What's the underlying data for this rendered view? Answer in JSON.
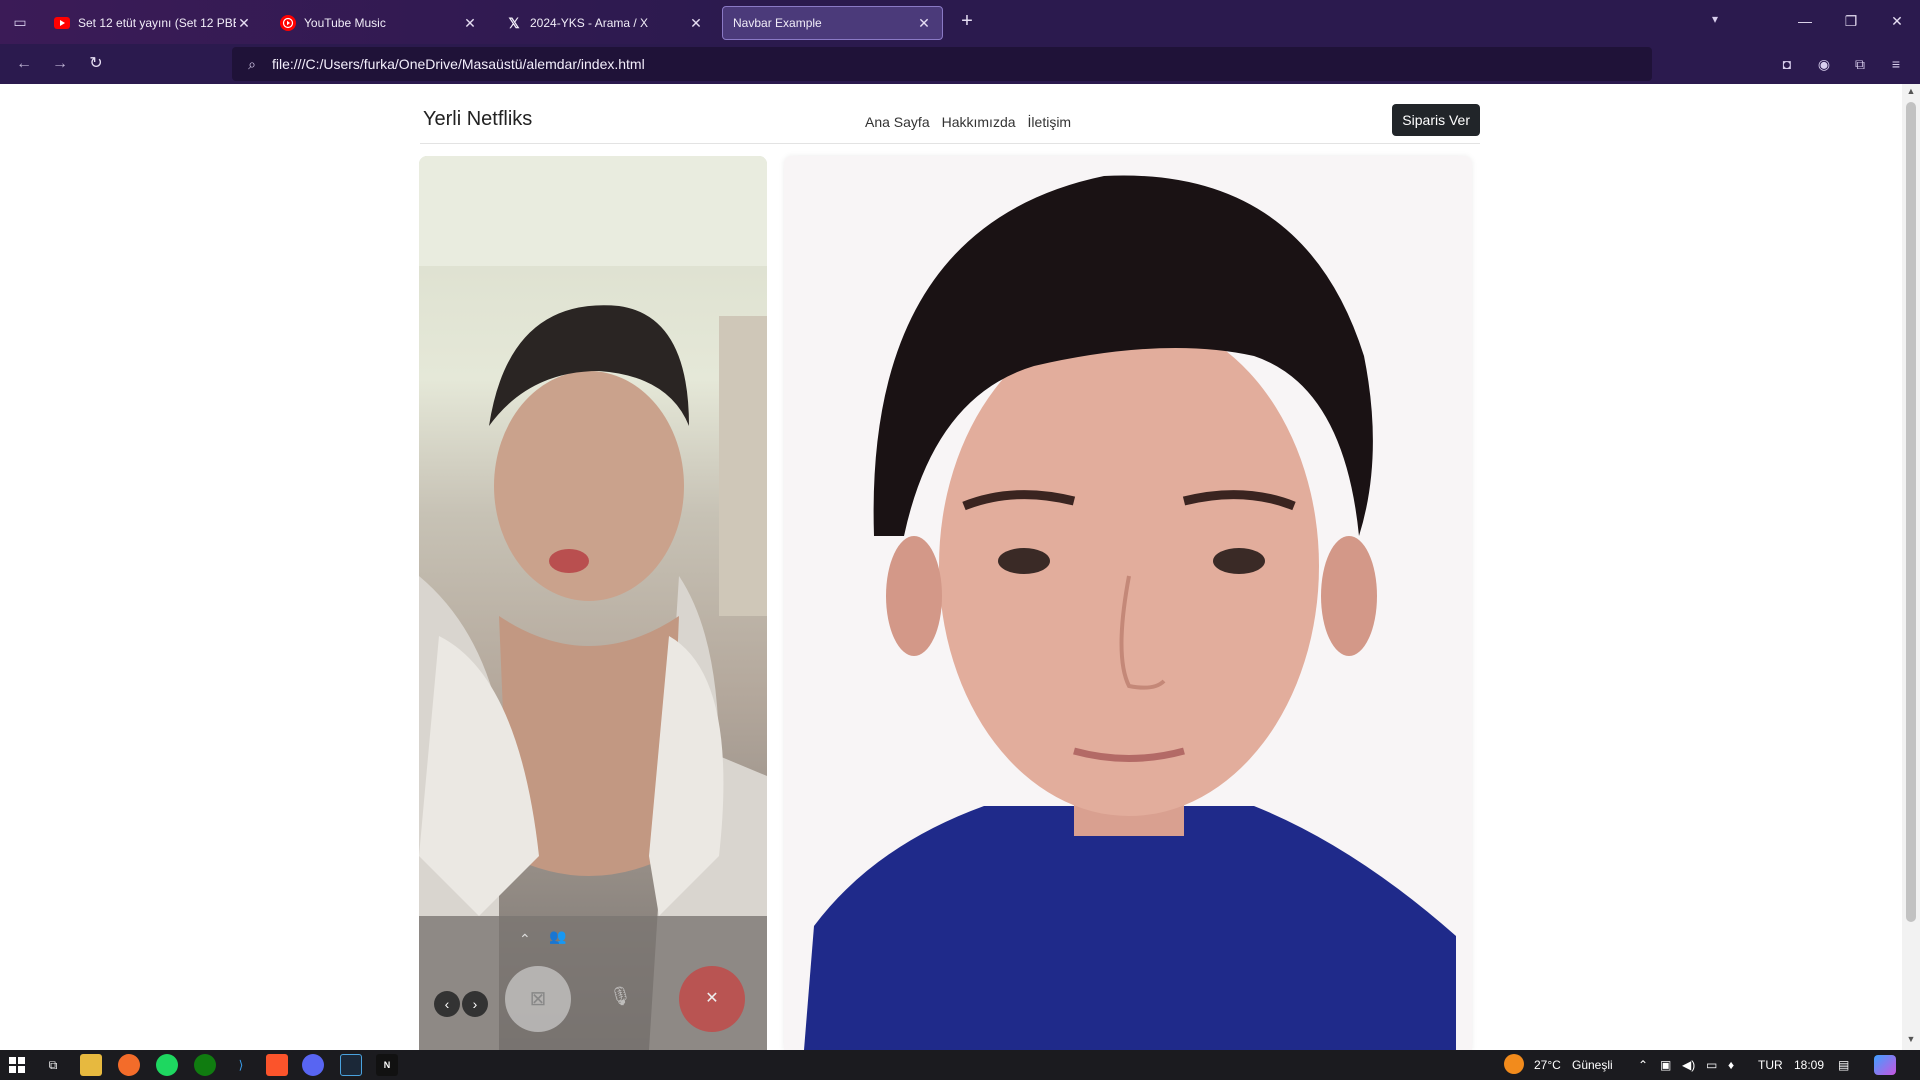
{
  "browser": {
    "tabs": [
      {
        "title": "Set 12 etüt yayını (Set 12 PBE y",
        "icon": "youtube-icon"
      },
      {
        "title": "YouTube Music",
        "icon": "youtube-music-icon"
      },
      {
        "title": "2024-YKS - Arama / X",
        "icon": "x-icon"
      },
      {
        "title": "Navbar Example",
        "icon": "page-icon"
      }
    ],
    "url": "file:///C:/Users/furka/OneDrive/Masaüstü/alemdar/index.html"
  },
  "site": {
    "brand": "Yerli Netfliks",
    "menu": [
      "Ana Sayfa",
      "Hakkımızda",
      "İletişim"
    ],
    "order_button": "Siparis Ver"
  },
  "taskbar": {
    "weather_temp": "27°C",
    "weather_text": "Güneşli",
    "language": "TUR",
    "time": "18:09"
  },
  "colors": {
    "chrome_bg": "#2b1a4e",
    "active_tab_bg": "#4b3a7a",
    "button_dark": "#212529"
  }
}
